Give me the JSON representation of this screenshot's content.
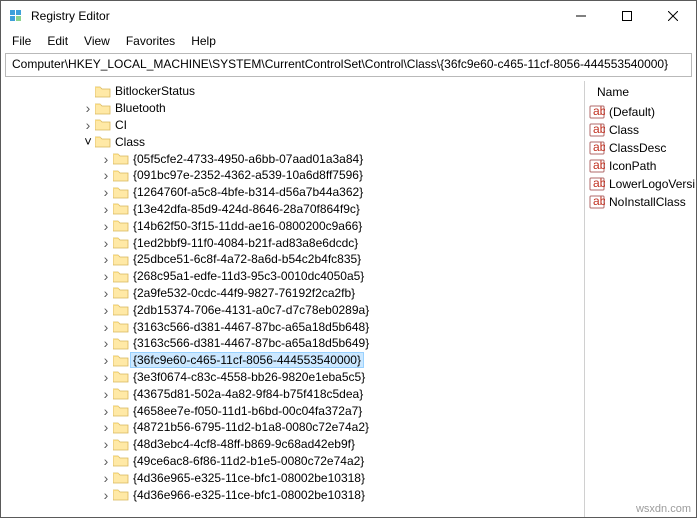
{
  "titlebar": {
    "title": "Registry Editor"
  },
  "menu": {
    "file": "File",
    "edit": "Edit",
    "view": "View",
    "favorites": "Favorites",
    "help": "Help"
  },
  "addressbar": {
    "path": "Computer\\HKEY_LOCAL_MACHINE\\SYSTEM\\CurrentControlSet\\Control\\Class\\{36fc9e60-c465-11cf-8056-444553540000}"
  },
  "tree": {
    "top": [
      {
        "label": "BitlockerStatus",
        "twisty": ""
      },
      {
        "label": "Bluetooth",
        "twisty": ">"
      },
      {
        "label": "CI",
        "twisty": ">"
      }
    ],
    "class_label": "Class",
    "class_children": [
      "{05f5cfe2-4733-4950-a6bb-07aad01a3a84}",
      "{091bc97e-2352-4362-a539-10a6d8ff7596}",
      "{1264760f-a5c8-4bfe-b314-d56a7b44a362}",
      "{13e42dfa-85d9-424d-8646-28a70f864f9c}",
      "{14b62f50-3f15-11dd-ae16-0800200c9a66}",
      "{1ed2bbf9-11f0-4084-b21f-ad83a8e6dcdc}",
      "{25dbce51-6c8f-4a72-8a6d-b54c2b4fc835}",
      "{268c95a1-edfe-11d3-95c3-0010dc4050a5}",
      "{2a9fe532-0cdc-44f9-9827-76192f2ca2fb}",
      "{2db15374-706e-4131-a0c7-d7c78eb0289a}",
      "{3163c566-d381-4467-87bc-a65a18d5b648}",
      "{3163c566-d381-4467-87bc-a65a18d5b649}",
      "{36fc9e60-c465-11cf-8056-444553540000}",
      "{3e3f0674-c83c-4558-bb26-9820e1eba5c5}",
      "{43675d81-502a-4a82-9f84-b75f418c5dea}",
      "{4658ee7e-f050-11d1-b6bd-00c04fa372a7}",
      "{48721b56-6795-11d2-b1a8-0080c72e74a2}",
      "{48d3ebc4-4cf8-48ff-b869-9c68ad42eb9f}",
      "{49ce6ac8-6f86-11d2-b1e5-0080c72e74a2}",
      "{4d36e965-e325-11ce-bfc1-08002be10318}",
      "{4d36e966-e325-11ce-bfc1-08002be10318}"
    ],
    "selected_index": 12
  },
  "values": {
    "header": {
      "name": "Name"
    },
    "rows": [
      {
        "icon": "string",
        "label": "(Default)"
      },
      {
        "icon": "string",
        "label": "Class"
      },
      {
        "icon": "string",
        "label": "ClassDesc"
      },
      {
        "icon": "string",
        "label": "IconPath"
      },
      {
        "icon": "string",
        "label": "LowerLogoVersi"
      },
      {
        "icon": "string",
        "label": "NoInstallClass"
      }
    ]
  },
  "watermark": "wsxdn.com"
}
